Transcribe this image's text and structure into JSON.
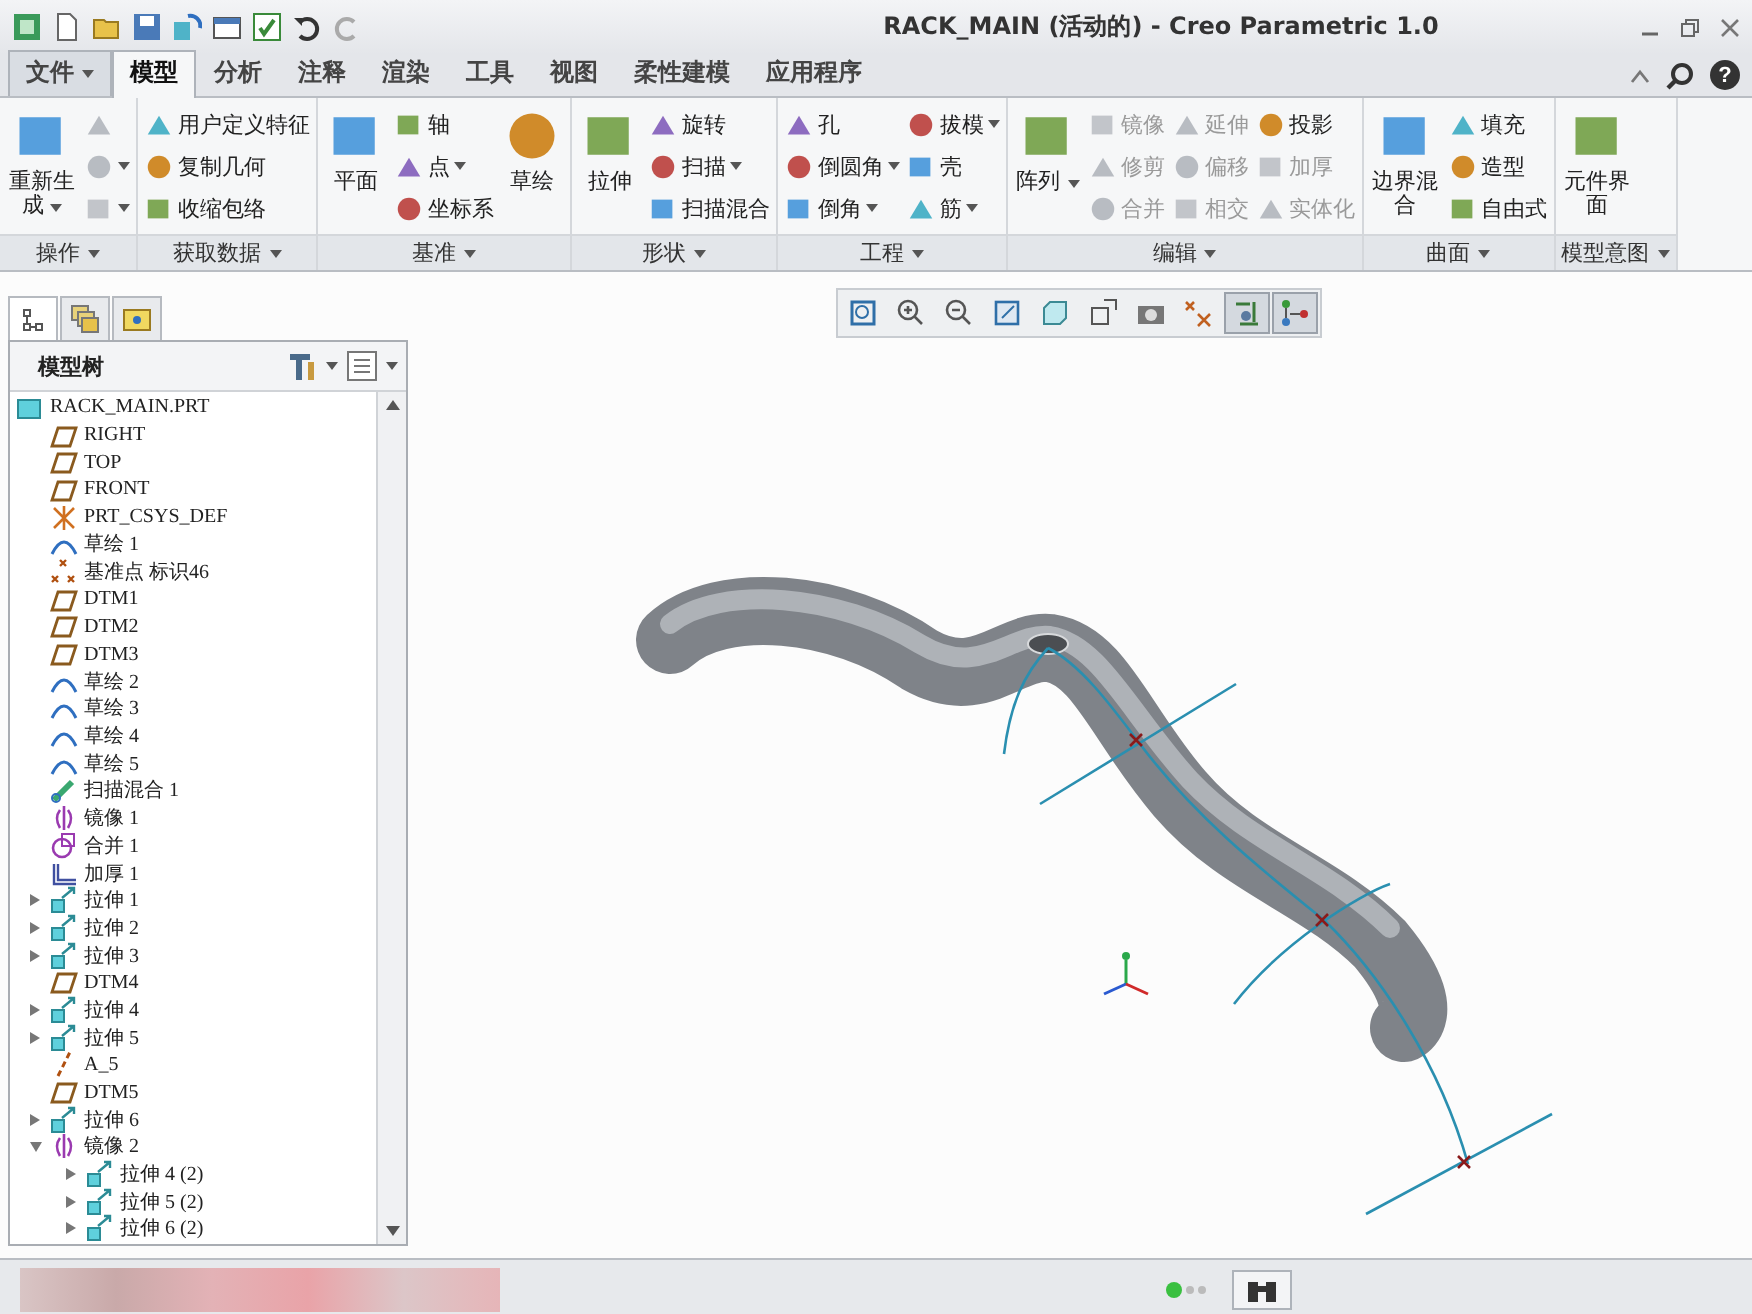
{
  "window": {
    "title": "RACK_MAIN (活动的) - Creo Parametric 1.0",
    "help": "?"
  },
  "menu_tabs": [
    {
      "label": "文件",
      "kind": "menu",
      "selected": false
    },
    {
      "label": "模型",
      "kind": "tab",
      "selected": true
    },
    {
      "label": "分析",
      "kind": "tab",
      "selected": false
    },
    {
      "label": "注释",
      "kind": "tab",
      "selected": false
    },
    {
      "label": "渲染",
      "kind": "tab",
      "selected": false
    },
    {
      "label": "工具",
      "kind": "tab",
      "selected": false
    },
    {
      "label": "视图",
      "kind": "tab",
      "selected": false
    },
    {
      "label": "柔性建模",
      "kind": "tab",
      "selected": false
    },
    {
      "label": "应用程序",
      "kind": "tab",
      "selected": false
    }
  ],
  "ribbon_groups": [
    {
      "label": "操作",
      "columns": [
        {
          "kind": "large",
          "label": "重新生成",
          "dropdown": true,
          "disabled": false
        },
        {
          "kind": "stack",
          "items": [
            {
              "dropdown": false,
              "disabled": true
            },
            {
              "dropdown": true,
              "disabled": true
            },
            {
              "dropdown": true,
              "disabled": true
            }
          ]
        }
      ]
    },
    {
      "label": "获取数据",
      "columns": [
        {
          "kind": "stack",
          "items": [
            {
              "label": "用户定义特征",
              "dropdown": false,
              "disabled": false
            },
            {
              "label": "复制几何",
              "dropdown": false,
              "disabled": false
            },
            {
              "label": "收缩包络",
              "dropdown": false,
              "disabled": false
            }
          ]
        }
      ]
    },
    {
      "label": "基准",
      "columns": [
        {
          "kind": "large",
          "label": "平面",
          "dropdown": false,
          "disabled": false
        },
        {
          "kind": "stack",
          "items": [
            {
              "label": "轴",
              "dropdown": false,
              "disabled": false
            },
            {
              "label": "点",
              "dropdown": true,
              "disabled": false
            },
            {
              "label": "坐标系",
              "dropdown": false,
              "disabled": false
            }
          ]
        },
        {
          "kind": "large",
          "label": "草绘",
          "dropdown": false,
          "disabled": false
        }
      ]
    },
    {
      "label": "形状",
      "columns": [
        {
          "kind": "large",
          "label": "拉伸",
          "dropdown": false,
          "disabled": false
        },
        {
          "kind": "stack",
          "items": [
            {
              "label": "旋转",
              "dropdown": false,
              "disabled": false
            },
            {
              "label": "扫描",
              "dropdown": true,
              "disabled": false
            },
            {
              "label": "扫描混合",
              "dropdown": false,
              "disabled": false
            }
          ]
        }
      ]
    },
    {
      "label": "工程",
      "columns": [
        {
          "kind": "stack",
          "items": [
            {
              "label": "孔",
              "dropdown": false,
              "disabled": false
            },
            {
              "label": "倒圆角",
              "dropdown": true,
              "disabled": false
            },
            {
              "label": "倒角",
              "dropdown": true,
              "disabled": false
            }
          ]
        },
        {
          "kind": "stack",
          "items": [
            {
              "label": "拔模",
              "dropdown": true,
              "disabled": false
            },
            {
              "label": "壳",
              "dropdown": false,
              "disabled": false
            },
            {
              "label": "筋",
              "dropdown": true,
              "disabled": false
            }
          ]
        }
      ]
    },
    {
      "label": "编辑",
      "columns": [
        {
          "kind": "large",
          "label": "阵列",
          "dropdown": true,
          "disabled": false
        },
        {
          "kind": "stack",
          "items": [
            {
              "label": "镜像",
              "dropdown": false,
              "disabled": true
            },
            {
              "label": "修剪",
              "dropdown": false,
              "disabled": true
            },
            {
              "label": "合并",
              "dropdown": false,
              "disabled": true
            }
          ]
        },
        {
          "kind": "stack",
          "items": [
            {
              "label": "延伸",
              "dropdown": false,
              "disabled": true
            },
            {
              "label": "偏移",
              "dropdown": false,
              "disabled": true
            },
            {
              "label": "相交",
              "dropdown": false,
              "disabled": true
            }
          ]
        },
        {
          "kind": "stack",
          "items": [
            {
              "label": "投影",
              "dropdown": false,
              "disabled": false
            },
            {
              "label": "加厚",
              "dropdown": false,
              "disabled": true
            },
            {
              "label": "实体化",
              "dropdown": false,
              "disabled": true
            }
          ]
        }
      ]
    },
    {
      "label": "曲面",
      "columns": [
        {
          "kind": "large",
          "label": "边界混合",
          "dropdown": false,
          "disabled": false
        },
        {
          "kind": "stack",
          "items": [
            {
              "label": "填充",
              "dropdown": false,
              "disabled": false
            },
            {
              "label": "造型",
              "dropdown": false,
              "disabled": false
            },
            {
              "label": "自由式",
              "dropdown": false,
              "disabled": false
            }
          ]
        }
      ]
    },
    {
      "label": "模型意图",
      "columns": [
        {
          "kind": "large",
          "label": "元件界面",
          "dropdown": false,
          "disabled": false
        }
      ]
    }
  ],
  "view_toolbar": [
    {
      "selected": false
    },
    {
      "selected": false
    },
    {
      "selected": false
    },
    {
      "selected": false
    },
    {
      "selected": false
    },
    {
      "selected": false
    },
    {
      "selected": false
    },
    {
      "selected": false
    },
    {
      "selected": true
    },
    {
      "selected": true
    }
  ],
  "model_tree": {
    "tabs": [
      {
        "selected": true
      },
      {
        "selected": false
      },
      {
        "selected": false
      }
    ],
    "title": "模型树",
    "items": [
      {
        "label": "RACK_MAIN.PRT",
        "kind": "part",
        "children": [
          {
            "label": "RIGHT",
            "kind": "plane"
          },
          {
            "label": "TOP",
            "kind": "plane"
          },
          {
            "label": "FRONT",
            "kind": "plane"
          },
          {
            "label": "PRT_CSYS_DEF",
            "kind": "csys"
          },
          {
            "label": "草绘 1",
            "kind": "sketch"
          },
          {
            "label": "基准点 标识46",
            "kind": "point"
          },
          {
            "label": "DTM1",
            "kind": "plane"
          },
          {
            "label": "DTM2",
            "kind": "plane"
          },
          {
            "label": "DTM3",
            "kind": "plane"
          },
          {
            "label": "草绘 2",
            "kind": "sketch"
          },
          {
            "label": "草绘 3",
            "kind": "sketch"
          },
          {
            "label": "草绘 4",
            "kind": "sketch"
          },
          {
            "label": "草绘 5",
            "kind": "sketch"
          },
          {
            "label": "扫描混合 1",
            "kind": "sweep"
          },
          {
            "label": "镜像 1",
            "kind": "mirror"
          },
          {
            "label": "合并 1",
            "kind": "merge"
          },
          {
            "label": "加厚 1",
            "kind": "thicken"
          },
          {
            "label": "拉伸 1",
            "kind": "extrude",
            "expanded": false
          },
          {
            "label": "拉伸 2",
            "kind": "extrude",
            "expanded": false
          },
          {
            "label": "拉伸 3",
            "kind": "extrude",
            "expanded": false
          },
          {
            "label": "DTM4",
            "kind": "plane"
          },
          {
            "label": "拉伸 4",
            "kind": "extrude",
            "expanded": false
          },
          {
            "label": "拉伸 5",
            "kind": "extrude",
            "expanded": false
          },
          {
            "label": "A_5",
            "kind": "axis"
          },
          {
            "label": "DTM5",
            "kind": "plane"
          },
          {
            "label": "拉伸 6",
            "kind": "extrude",
            "expanded": false
          },
          {
            "label": "镜像 2",
            "kind": "mirror",
            "expanded": true,
            "children": [
              {
                "label": "拉伸 4 (2)",
                "kind": "extrude",
                "expanded": false
              },
              {
                "label": "拉伸 5 (2)",
                "kind": "extrude",
                "expanded": false
              },
              {
                "label": "拉伸 6 (2)",
                "kind": "extrude",
                "expanded": false
              }
            ]
          }
        ]
      }
    ]
  }
}
